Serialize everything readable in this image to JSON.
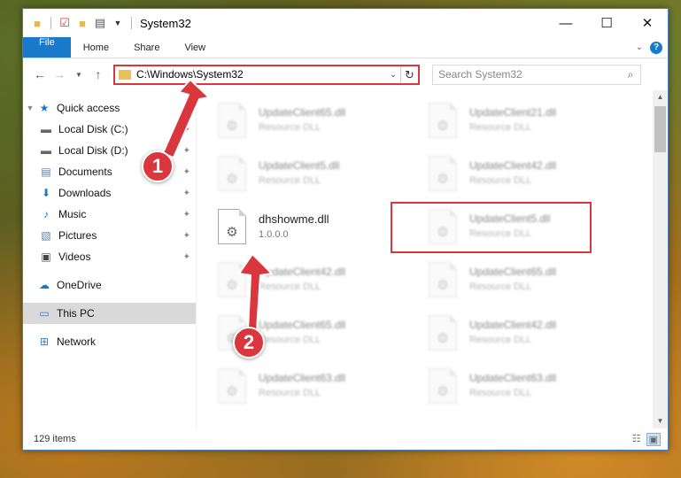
{
  "window": {
    "title": "System32",
    "controls": {
      "minimize": "—",
      "maximize": "☐",
      "close": "✕"
    }
  },
  "ribbon": {
    "tabs": [
      "File",
      "Home",
      "Share",
      "View"
    ]
  },
  "address": {
    "path": "C:\\Windows\\System32"
  },
  "search": {
    "placeholder": "Search System32"
  },
  "nav": {
    "quick_access": "Quick access",
    "items": [
      {
        "label": "Local Disk (C:)",
        "icon": "drive-icon"
      },
      {
        "label": "Local Disk (D:)",
        "icon": "drive-icon"
      },
      {
        "label": "Documents",
        "icon": "documents-icon"
      },
      {
        "label": "Downloads",
        "icon": "downloads-icon"
      },
      {
        "label": "Music",
        "icon": "music-icon"
      },
      {
        "label": "Pictures",
        "icon": "pictures-icon"
      },
      {
        "label": "Videos",
        "icon": "videos-icon"
      }
    ],
    "onedrive": "OneDrive",
    "this_pc": "This PC",
    "network": "Network"
  },
  "files": [
    {
      "name": "UpdateClient65.dll",
      "desc": "Resource DLL",
      "blur": true
    },
    {
      "name": "UpdateClient21.dll",
      "desc": "Resource DLL",
      "blur": true
    },
    {
      "name": "UpdateClient5.dll",
      "desc": "Resource DLL",
      "blur": true
    },
    {
      "name": "UpdateClient42.dll",
      "desc": "Resource DLL",
      "blur": true
    },
    {
      "name": "dhshowme.dll",
      "desc": "1.0.0.0",
      "blur": false
    },
    {
      "name": "UpdateClient5.dll",
      "desc": "Resource DLL",
      "blur": true
    },
    {
      "name": "UpdateClient42.dll",
      "desc": "Resource DLL",
      "blur": true
    },
    {
      "name": "UpdateClient65.dll",
      "desc": "Resource DLL",
      "blur": true
    },
    {
      "name": "UpdateClient65.dll",
      "desc": "Resource DLL",
      "blur": true
    },
    {
      "name": "UpdateClient42.dll",
      "desc": "Resource DLL",
      "blur": true
    },
    {
      "name": "UpdateClient63.dll",
      "desc": "Resource DLL",
      "blur": true
    },
    {
      "name": "UpdateClient63.dll",
      "desc": "Resource DLL",
      "blur": true
    }
  ],
  "status": {
    "count": "129 items"
  },
  "markers": [
    "1",
    "2"
  ],
  "colors": {
    "accent": "#1979ca",
    "highlight": "#d9363e"
  }
}
